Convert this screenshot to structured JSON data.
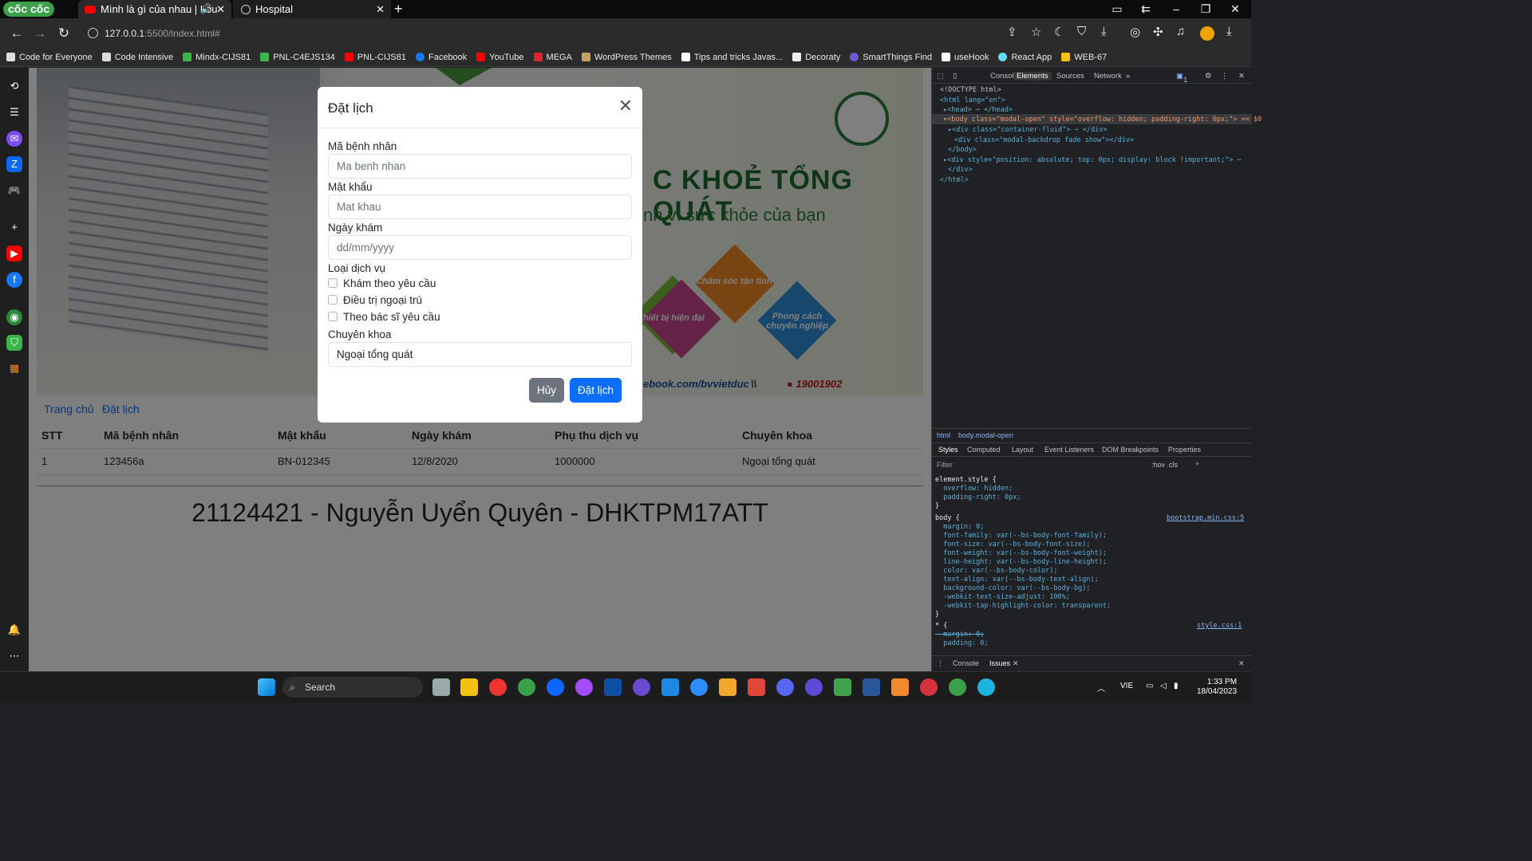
{
  "browser": {
    "logo": "cốc cốc",
    "tabs": [
      {
        "title": "Mình là gì của nhau | Lou",
        "active": false
      },
      {
        "title": "Hospital",
        "active": true
      }
    ],
    "url_host": "127.0.0.1",
    "url_rest": ":5500/index.html#",
    "bookmarks": [
      "Code for Everyone",
      "Code Intensive",
      "Mindx-CIJS81",
      "PNL-C4EJS134",
      "PNL-CIJS81",
      "Facebook",
      "YouTube",
      "MEGA",
      "WordPress Themes",
      "Tips and tricks Javas...",
      "Decoraty",
      "SmartThings Find",
      "useHook",
      "React App",
      "WEB-67"
    ]
  },
  "page": {
    "banner": {
      "title": "C KHOẺ TỔNG QUÁT",
      "subtitle": "nh vì sức khỏe của bạn",
      "diamonds": [
        "Thiết bị hiện đại",
        "Chăm sóc tận tình",
        "Phong cách chuyên nghiệp"
      ],
      "facebook": "ebook.com/bvvietduc",
      "separator": "\\\\",
      "phone": "19001902"
    },
    "nav": [
      "Trang chủ",
      "Đặt lịch"
    ],
    "table": {
      "headers": [
        "STT",
        "Mã bệnh nhân",
        "Mật khẩu",
        "Ngày khám",
        "Phụ thu dịch vụ",
        "Chuyên khoa"
      ],
      "rows": [
        [
          "1",
          "123456a",
          "BN-012345",
          "12/8/2020",
          "1000000",
          "Ngoại tổng quát"
        ]
      ]
    },
    "footer_title": "21124421 - Nguyễn Uyển Quyên - DHKTPM17ATT"
  },
  "modal": {
    "title": "Đặt lịch",
    "close": "✕",
    "fields": [
      {
        "label": "Mã bệnh nhân",
        "placeholder": "Ma benh nhan"
      },
      {
        "label": "Mật khẩu",
        "placeholder": "Mat khau"
      },
      {
        "label": "Ngày khám",
        "placeholder": "dd/mm/yyyy"
      }
    ],
    "service_label": "Loại dịch vụ",
    "services": [
      "Khám theo yêu cầu",
      "Điều trị ngoại trú",
      "Theo bác sĩ yêu cầu"
    ],
    "specialty_label": "Chuyên khoa",
    "specialty_value": "Ngoại tổng quát",
    "cancel": "Hủy",
    "submit": "Đặt lịch"
  },
  "devtools": {
    "tabs": [
      "Console",
      "Elements",
      "Sources",
      "Network"
    ],
    "issues_badge": "1",
    "dom": [
      "<!DOCTYPE html>",
      "<html lang=\"en\">",
      "▸<head> ⋯ </head>",
      "▾<body class=\"modal-open\" style=\"overflow: hidden; padding-right: 0px;\"> == $0",
      "▸<div class=\"container-fluid\"> ⋯ </div>",
      "<div class=\"modal-backdrop fade show\"></div>",
      "</body>",
      "▸<div style=\"position: absolute; top: 0px; display: block !important;\"> ⋯",
      "</div>",
      "</html>"
    ],
    "breadcrumb": [
      "html",
      "body.modal-open"
    ],
    "style_tabs": [
      "Styles",
      "Computed",
      "Layout",
      "Event Listeners",
      "DOM Breakpoints",
      "Properties"
    ],
    "filter_placeholder": "Filter",
    "filter_tools": ":hov .cls",
    "css_lines": [
      "element.style {",
      "  overflow: hidden;",
      "  padding-right: 0px;",
      "}",
      "body {",
      "  margin: 0;",
      "  font-family: var(--bs-body-font-family);",
      "  font-size: var(--bs-body-font-size);",
      "  font-weight: var(--bs-body-font-weight);",
      "  line-height: var(--bs-body-line-height);",
      "  color: var(--bs-body-color);",
      "  text-align: var(--bs-body-text-align);",
      "  background-color: var(--bs-body-bg);",
      "  -webkit-text-size-adjust: 100%;",
      "  -webkit-tap-highlight-color: transparent;",
      "}",
      "* {",
      "  margin: 0;",
      "  padding: 0;",
      "}"
    ],
    "css_sources": [
      "bootstrap.min.css:5",
      "style.css:1"
    ],
    "drawer_tabs": [
      "Console",
      "Issues"
    ]
  },
  "taskbar": {
    "search": "Search",
    "lang": "VIE",
    "time": "1:33 PM",
    "date": "18/04/2023"
  }
}
